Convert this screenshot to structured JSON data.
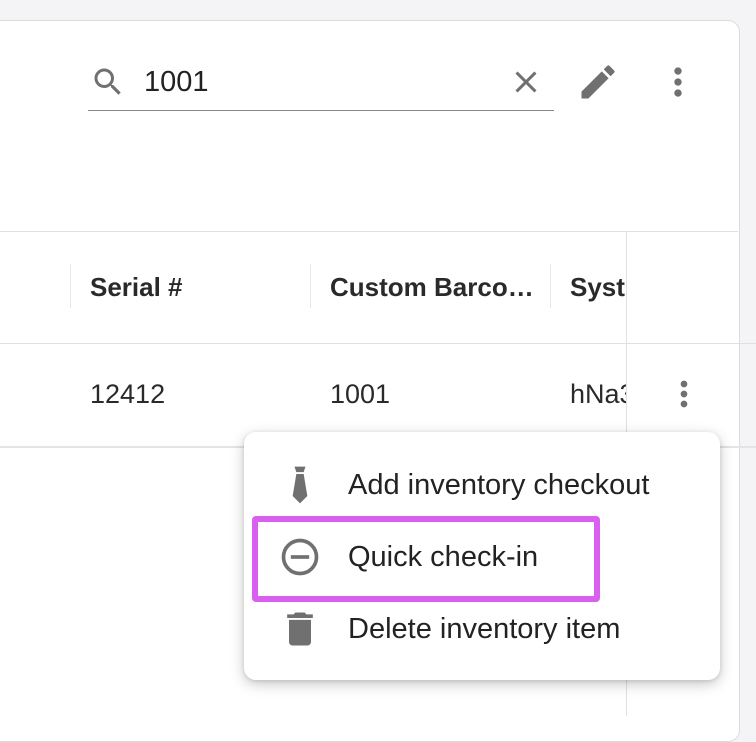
{
  "toolbar": {
    "search": {
      "value": "1001",
      "placeholder": ""
    },
    "icons": [
      "search-icon",
      "clear-icon",
      "edit-pencil-icon",
      "more-vert-icon"
    ]
  },
  "table": {
    "columns": [
      "Serial #",
      "Custom Barco…",
      "Syst"
    ],
    "rows": [
      {
        "serial": "12412",
        "custom_barcode": "1001",
        "system": "hNa3"
      }
    ]
  },
  "context_menu": {
    "items": [
      {
        "label": "Add inventory checkout",
        "icon": "tie-icon"
      },
      {
        "label": "Quick check-in",
        "icon": "minus-circle-icon"
      },
      {
        "label": "Delete inventory item",
        "icon": "trash-icon"
      }
    ]
  },
  "colors": {
    "highlight": "#d95ff0",
    "icon": "#707070",
    "text": "#222222"
  }
}
